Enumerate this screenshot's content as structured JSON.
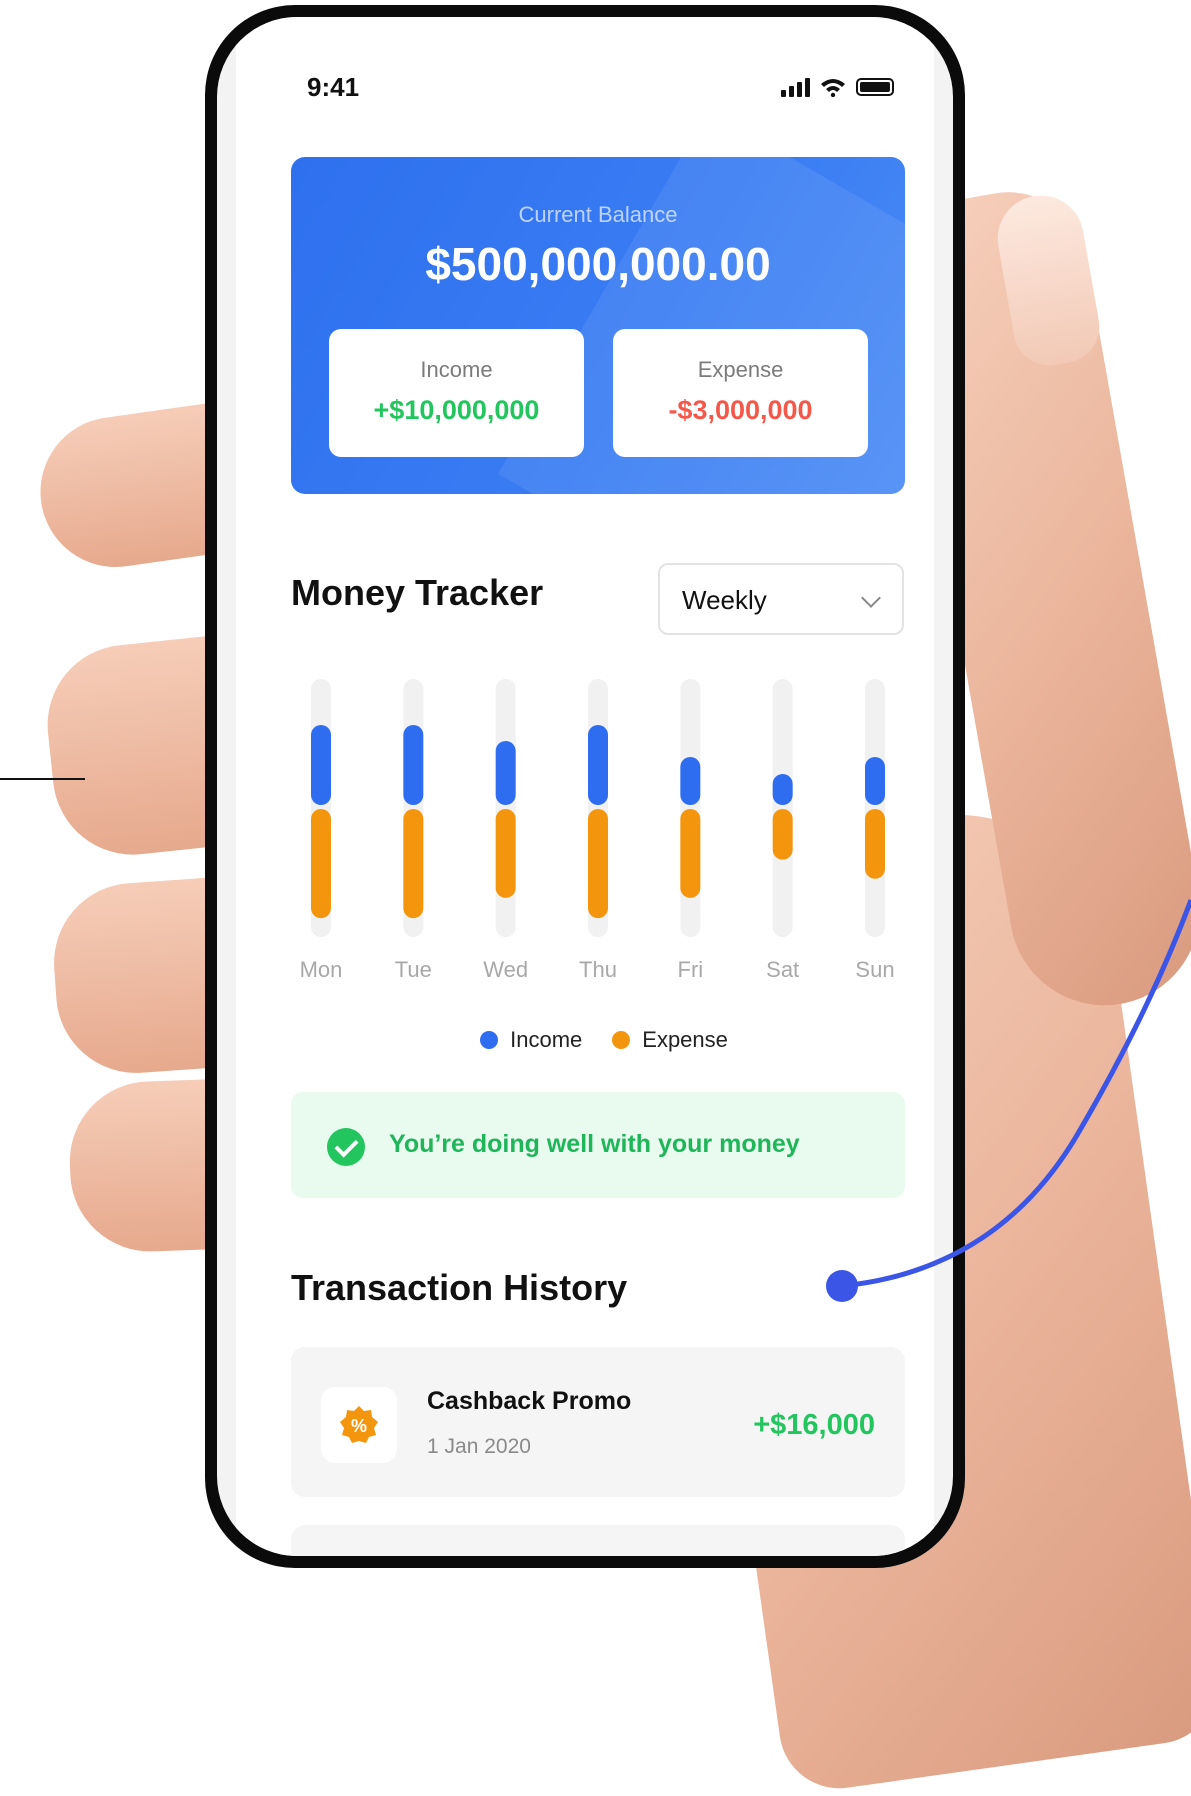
{
  "status_bar": {
    "time": "9:41"
  },
  "balance": {
    "label": "Current Balance",
    "amount": "$500,000,000.00",
    "income_label": "Income",
    "income_value": "+$10,000,000",
    "expense_label": "Expense",
    "expense_value": "-$3,000,000"
  },
  "tracker": {
    "title": "Money Tracker",
    "period": "Weekly"
  },
  "chart_data": {
    "type": "bar",
    "categories": [
      "Mon",
      "Tue",
      "Wed",
      "Thu",
      "Fri",
      "Sat",
      "Sun"
    ],
    "series": [
      {
        "name": "Income",
        "values": [
          80,
          80,
          64,
          80,
          48,
          31,
          48
        ]
      },
      {
        "name": "Expense",
        "values": [
          97,
          97,
          79,
          97,
          79,
          45,
          62
        ]
      }
    ],
    "colors": {
      "Income": "#2f6df0",
      "Expense": "#f4960d",
      "track": "#f1f1f1"
    }
  },
  "legend": {
    "income": "Income",
    "expense": "Expense"
  },
  "tip": {
    "text": "You’re doing well with your money"
  },
  "history": {
    "title": "Transaction History",
    "items": [
      {
        "name": "Cashback Promo",
        "date": "1 Jan 2020",
        "amount": "+$16,000",
        "icon": "percent-badge-icon"
      }
    ]
  }
}
